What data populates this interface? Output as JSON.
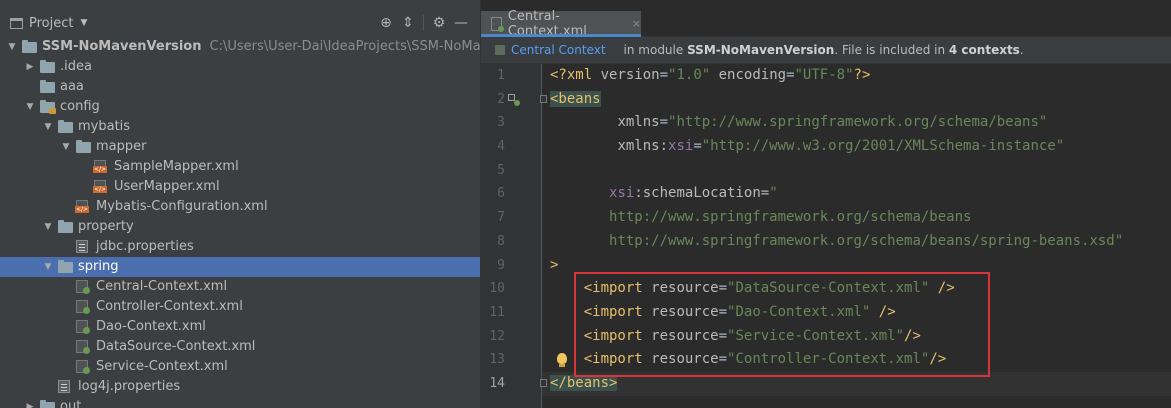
{
  "project_panel": {
    "title": "Project",
    "tree": [
      {
        "depth": 0,
        "arrow": "open",
        "icon": "folder",
        "label": "SSM-NoMavenVersion",
        "bold": true,
        "path": "C:\\Users\\User-Dai\\IdeaProjects\\SSM-NoMavenVer"
      },
      {
        "depth": 1,
        "arrow": "closed",
        "icon": "folder",
        "label": ".idea"
      },
      {
        "depth": 1,
        "arrow": "none",
        "icon": "folder",
        "label": "aaa"
      },
      {
        "depth": 1,
        "arrow": "open",
        "icon": "folder-config",
        "label": "config"
      },
      {
        "depth": 2,
        "arrow": "open",
        "icon": "folder",
        "label": "mybatis"
      },
      {
        "depth": 3,
        "arrow": "open",
        "icon": "folder",
        "label": "mapper"
      },
      {
        "depth": 4,
        "arrow": "none",
        "icon": "xml",
        "label": "SampleMapper.xml"
      },
      {
        "depth": 4,
        "arrow": "none",
        "icon": "xml",
        "label": "UserMapper.xml"
      },
      {
        "depth": 3,
        "arrow": "none",
        "icon": "xml",
        "label": "Mybatis-Configuration.xml"
      },
      {
        "depth": 2,
        "arrow": "open",
        "icon": "folder",
        "label": "property"
      },
      {
        "depth": 3,
        "arrow": "none",
        "icon": "properties",
        "label": "jdbc.properties"
      },
      {
        "depth": 2,
        "arrow": "open",
        "icon": "folder",
        "label": "spring",
        "selected": true
      },
      {
        "depth": 3,
        "arrow": "none",
        "icon": "spring-xml",
        "label": "Central-Context.xml"
      },
      {
        "depth": 3,
        "arrow": "none",
        "icon": "spring-xml",
        "label": "Controller-Context.xml"
      },
      {
        "depth": 3,
        "arrow": "none",
        "icon": "spring-xml",
        "label": "Dao-Context.xml"
      },
      {
        "depth": 3,
        "arrow": "none",
        "icon": "spring-xml",
        "label": "DataSource-Context.xml"
      },
      {
        "depth": 3,
        "arrow": "none",
        "icon": "spring-xml",
        "label": "Service-Context.xml"
      },
      {
        "depth": 2,
        "arrow": "none",
        "icon": "properties",
        "label": "log4j.properties"
      },
      {
        "depth": 1,
        "arrow": "closed",
        "icon": "folder",
        "label": "out"
      }
    ]
  },
  "editor": {
    "tab_label": "Central-Context.xml",
    "tab_close": "×",
    "info_bar": {
      "context_link": "Central Context",
      "text_prefix": "in module ",
      "module": "SSM-NoMavenVersion",
      "text_mid": ". File is included in ",
      "contexts": "4 contexts",
      "text_suffix": "."
    },
    "lines": [
      {
        "n": "1",
        "tokens": [
          [
            "t-pre",
            "<?xml "
          ],
          [
            "t-attr",
            "version"
          ],
          [
            "t-plain",
            "="
          ],
          [
            "t-val",
            "\"1.0\""
          ],
          [
            "t-plain",
            " "
          ],
          [
            "t-attr",
            "encoding"
          ],
          [
            "t-plain",
            "="
          ],
          [
            "t-val",
            "\"UTF-8\""
          ],
          [
            "t-pre",
            "?>"
          ]
        ]
      },
      {
        "n": "2",
        "tokens": [
          [
            "t-brkt",
            "<beans"
          ]
        ]
      },
      {
        "n": "3",
        "tokens": [
          [
            "t-plain",
            "        "
          ],
          [
            "t-attr",
            "xmlns"
          ],
          [
            "t-plain",
            "="
          ],
          [
            "t-val",
            "\"http://www.springframework.org/schema/beans\""
          ]
        ]
      },
      {
        "n": "4",
        "tokens": [
          [
            "t-plain",
            "        "
          ],
          [
            "t-attr",
            "xmlns:"
          ],
          [
            "t-ns",
            "xsi"
          ],
          [
            "t-plain",
            "="
          ],
          [
            "t-val",
            "\"http://www.w3.org/2001/XMLSchema-instance\""
          ]
        ]
      },
      {
        "n": "5",
        "tokens": []
      },
      {
        "n": "6",
        "tokens": [
          [
            "t-plain",
            "       "
          ],
          [
            "t-ns",
            "xsi"
          ],
          [
            "t-attr",
            ":schemaLocation"
          ],
          [
            "t-plain",
            "="
          ],
          [
            "t-val",
            "\""
          ]
        ]
      },
      {
        "n": "7",
        "tokens": [
          [
            "t-plain",
            "       "
          ],
          [
            "t-val",
            "http://www.springframework.org/schema/beans"
          ]
        ]
      },
      {
        "n": "8",
        "tokens": [
          [
            "t-plain",
            "       "
          ],
          [
            "t-val",
            "http://www.springframework.org/schema/beans/spring-beans.xsd\""
          ]
        ]
      },
      {
        "n": "9",
        "tokens": [
          [
            "t-tag",
            ">"
          ]
        ]
      },
      {
        "n": "10",
        "tokens": [
          [
            "t-plain",
            "    "
          ],
          [
            "t-tag",
            "<import "
          ],
          [
            "t-attr",
            "resource"
          ],
          [
            "t-plain",
            "="
          ],
          [
            "t-val",
            "\"DataSource-Context.xml\""
          ],
          [
            "t-plain",
            " "
          ],
          [
            "t-tag",
            "/>"
          ]
        ]
      },
      {
        "n": "11",
        "tokens": [
          [
            "t-plain",
            "    "
          ],
          [
            "t-tag",
            "<import "
          ],
          [
            "t-attr",
            "resource"
          ],
          [
            "t-plain",
            "="
          ],
          [
            "t-val",
            "\"Dao-Context.xml\""
          ],
          [
            "t-plain",
            " "
          ],
          [
            "t-tag",
            "/>"
          ]
        ]
      },
      {
        "n": "12",
        "tokens": [
          [
            "t-plain",
            "    "
          ],
          [
            "t-tag",
            "<import "
          ],
          [
            "t-attr",
            "resource"
          ],
          [
            "t-plain",
            "="
          ],
          [
            "t-val",
            "\"Service-Context.xml\""
          ],
          [
            "t-tag",
            "/>"
          ]
        ]
      },
      {
        "n": "13",
        "tokens": [
          [
            "t-plain",
            "    "
          ],
          [
            "t-tag",
            "<import "
          ],
          [
            "t-attr",
            "resource"
          ],
          [
            "t-plain",
            "="
          ],
          [
            "t-val",
            "\"Controller-Context.xml\""
          ],
          [
            "t-tag",
            "/>"
          ]
        ]
      },
      {
        "n": "14",
        "tokens": [
          [
            "t-brkt",
            "</beans>"
          ]
        ]
      }
    ],
    "current_line": "14"
  },
  "colors": {
    "selection": "#4b6eaf",
    "highlight_box": "#d9343b",
    "xml_tag": "#e8bf6a",
    "xml_value": "#6a8759",
    "xml_namespace": "#9876aa",
    "link": "#589df6"
  }
}
